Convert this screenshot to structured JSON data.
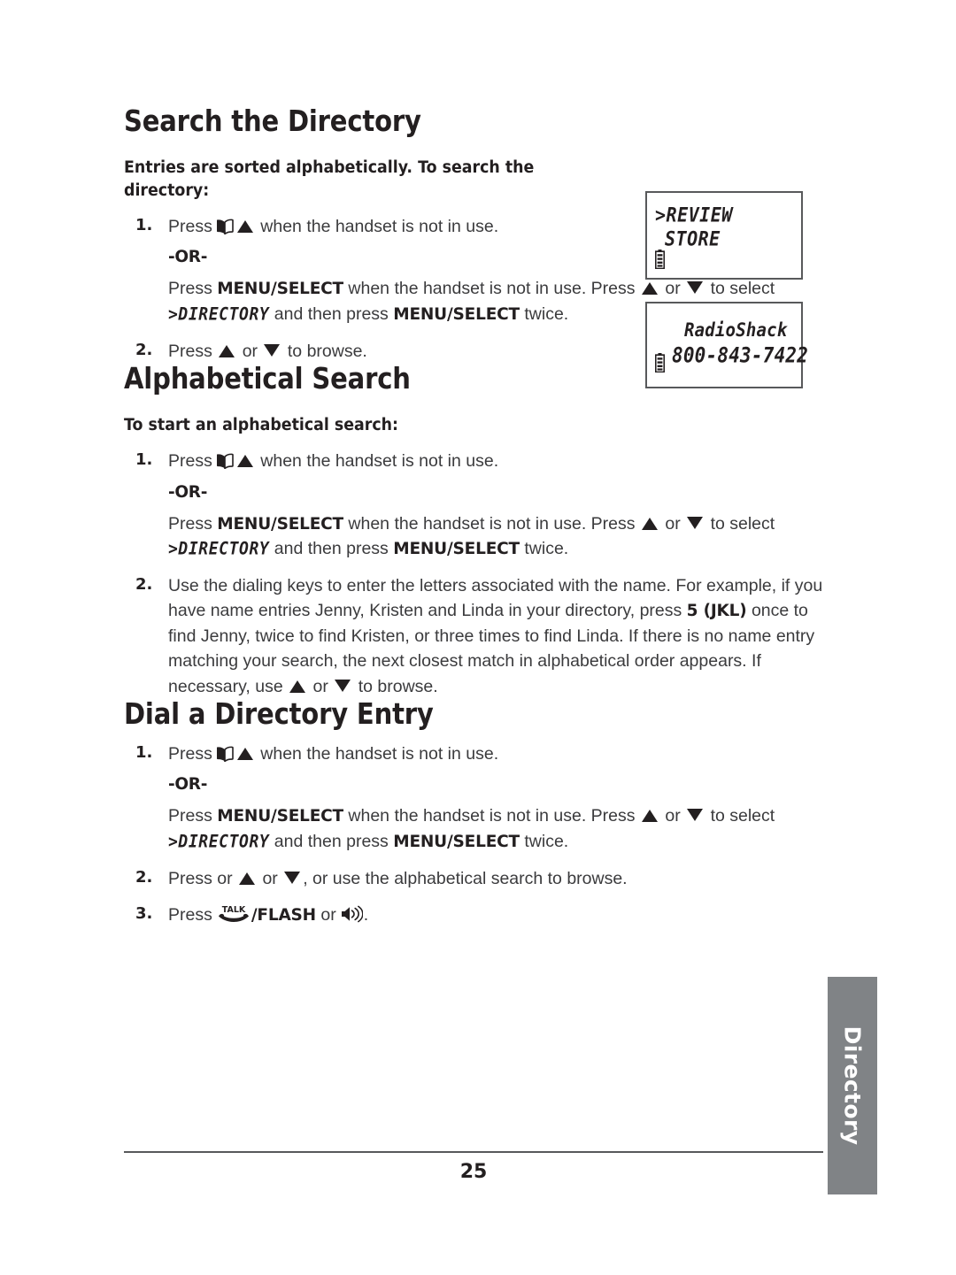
{
  "page": {
    "number": "25",
    "side_tab_label": "Directory"
  },
  "sections": [
    {
      "title": "Search the Directory",
      "lead": "Entries are sorted alphabetically. To search the directory:",
      "steps": {
        "s1_num": "1.",
        "s1_press": "Press",
        "s1_rest": "when the handset is not in use.",
        "or": "-OR-",
        "alt_a": "Press",
        "alt_menu_1": "MENU/SELECT",
        "alt_b": "when the handset is not in use. Press",
        "alt_or": "or",
        "alt_c": "to select",
        "alt_token": ">DIRECTORY",
        "alt_d": "and then press",
        "alt_menu_2": "MENU/SELECT",
        "alt_e": "twice.",
        "s2_num": "2.",
        "s2_a": "Press",
        "s2_or": "or",
        "s2_b": "to browse."
      }
    },
    {
      "title": "Alphabetical Search",
      "lead": "To start an alphabetical search:",
      "steps": {
        "s1_num": "1.",
        "s1_press": "Press",
        "s1_rest": "when the handset is not in use.",
        "or": "-OR-",
        "alt_a": "Press",
        "alt_menu_1": "MENU/SELECT",
        "alt_b": "when the handset is not in use. Press",
        "alt_or": "or",
        "alt_c": "to select",
        "alt_token": ">DIRECTORY",
        "alt_d": "and then press",
        "alt_menu_2": "MENU/SELECT",
        "alt_e": "twice.",
        "s2_num": "2.",
        "s2_a": "Use the dialing keys to enter the letters associated with the name. For example, if you have name entries Jenny, Kristen and Linda in your directory, press",
        "s2_key": "5 (JKL)",
        "s2_b": "once to find Jenny, twice to find Kristen, or three times to find Linda. If there is no name entry matching your search, the next closest match in alphabetical order appears. If necessary, use",
        "s2_or": "or",
        "s2_c": "to browse."
      }
    },
    {
      "title": "Dial a Directory Entry",
      "steps": {
        "s1_num": "1.",
        "s1_press": "Press",
        "s1_rest": "when the handset is not in use.",
        "or": "-OR-",
        "alt_a": "Press",
        "alt_menu_1": "MENU/SELECT",
        "alt_b": "when the handset is not in use. Press",
        "alt_or": "or",
        "alt_c": "to select",
        "alt_token": ">DIRECTORY",
        "alt_d": "and then press",
        "alt_menu_2": "MENU/SELECT",
        "alt_e": "twice.",
        "s2_num": "2.",
        "s2_a": "Press or",
        "s2_or": "or",
        "s2_b": ", or use the alphabetical search to browse.",
        "s3_num": "3.",
        "s3_a": "Press",
        "s3_talk_label": "TALK",
        "s3_flash": "/FLASH",
        "s3_or": "or",
        "s3_period": "."
      }
    }
  ],
  "lcd_displays": [
    {
      "line1": ">REVIEW",
      "line2": " STORE",
      "battery_icon": "battery-icon"
    },
    {
      "line1": "RadioShack",
      "line2": "800-843-7422",
      "battery_icon": "battery-icon"
    }
  ],
  "icons": {
    "book": "book-icon",
    "up_arrow": "up-arrow-icon",
    "down_arrow": "down-arrow-icon",
    "talk": "talk-handset-icon",
    "speaker": "speaker-icon"
  },
  "colors": {
    "text": "#231f20",
    "body_text": "#3b3b3d",
    "tab_gray": "#808386",
    "rule": "#58595b"
  }
}
